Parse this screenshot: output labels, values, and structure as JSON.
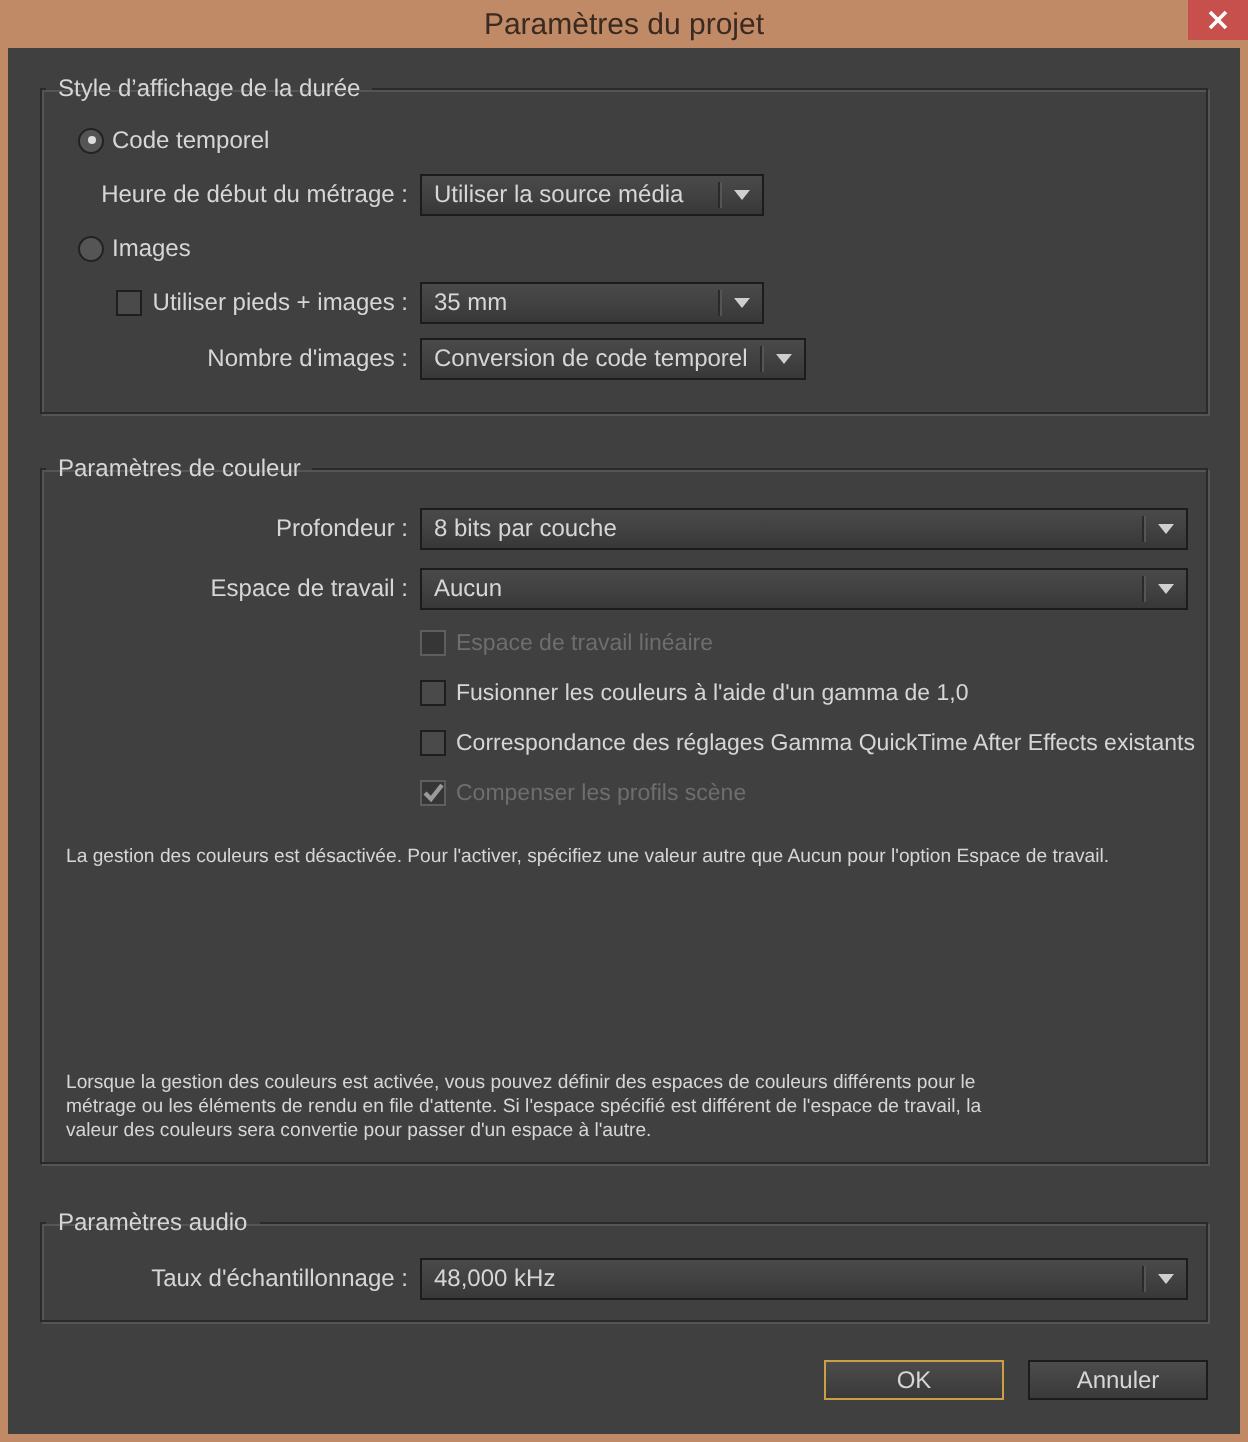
{
  "window": {
    "title": "Paramètres du projet"
  },
  "time_display": {
    "title": "Style d’affichage de la durée",
    "rows": [
      {
        "kind": "radio",
        "label": "Code temporel",
        "selected": true
      },
      {
        "kind": "dropdown",
        "label": "Heure de début du métrage :",
        "value": "Utiliser la source média"
      },
      {
        "kind": "radio",
        "label": "Images",
        "selected": false
      },
      {
        "kind": "check_dropdown",
        "label": "Utiliser pieds + images :",
        "checked": false,
        "value": "35 mm"
      },
      {
        "kind": "dropdown",
        "label": "Nombre d'images :",
        "value": "Conversion de code temporel"
      }
    ]
  },
  "color": {
    "title": "Paramètres de couleur",
    "dropdowns": [
      {
        "label": "Profondeur :",
        "value": "8 bits par couche"
      },
      {
        "label": "Espace de travail :",
        "value": "Aucun"
      }
    ],
    "checkboxes": [
      {
        "label": "Espace de travail linéaire",
        "checked": false,
        "disabled": true
      },
      {
        "label": "Fusionner les couleurs à l'aide d'un gamma de 1,0",
        "checked": false,
        "disabled": false
      },
      {
        "label": "Correspondance des réglages Gamma QuickTime After Effects existants",
        "checked": false,
        "disabled": false
      },
      {
        "label": "Compenser les profils scène",
        "checked": true,
        "disabled": true
      }
    ],
    "note": "La gestion des couleurs est désactivée. Pour l'activer, spécifiez une valeur autre que Aucun pour l'option Espace de travail.",
    "info": "Lorsque la gestion des couleurs est activée, vous pouvez définir des espaces de couleurs différents pour le métrage ou les éléments de rendu en file d'attente. Si l'espace spécifié est différent de l'espace de travail, la valeur des couleurs sera convertie pour passer d'un espace à l'autre."
  },
  "audio": {
    "title": "Paramètres audio",
    "dropdowns": [
      {
        "label": "Taux d'échantillonnage :",
        "value": "48,000 kHz"
      }
    ]
  },
  "buttons": [
    {
      "label": "OK",
      "default": true
    },
    {
      "label": "Annuler",
      "default": false
    }
  ]
}
